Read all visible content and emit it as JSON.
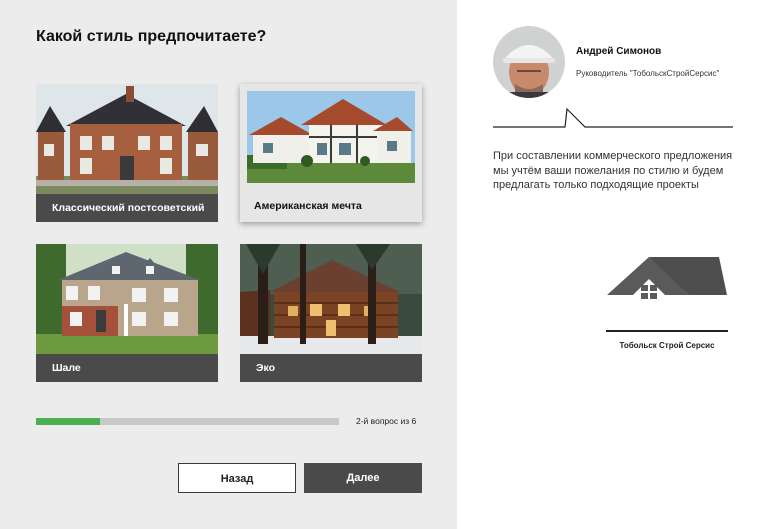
{
  "question": {
    "title": "Какой стиль предпочитаете?"
  },
  "options": [
    {
      "label": "Классический постсоветский",
      "selected": false
    },
    {
      "label": "Американская мечта",
      "selected": true
    },
    {
      "label": "Шале",
      "selected": false
    },
    {
      "label": "Эко",
      "selected": false
    }
  ],
  "progress": {
    "fraction": 0.21,
    "text": "2-й вопрос из 6",
    "color": "#4caf50"
  },
  "buttons": {
    "back": "Назад",
    "next": "Далее"
  },
  "manager": {
    "name": "Андрей Симонов",
    "role": "Руководитель \"ТобольскСтройСерсис\""
  },
  "description": "При составлении коммерческого предложения мы учтём ваши пожелания по стилю и будем предлагать только подходящие проекты",
  "logo": {
    "text": "Тобольск Строй Серсис",
    "icon": "house-logo-icon"
  }
}
